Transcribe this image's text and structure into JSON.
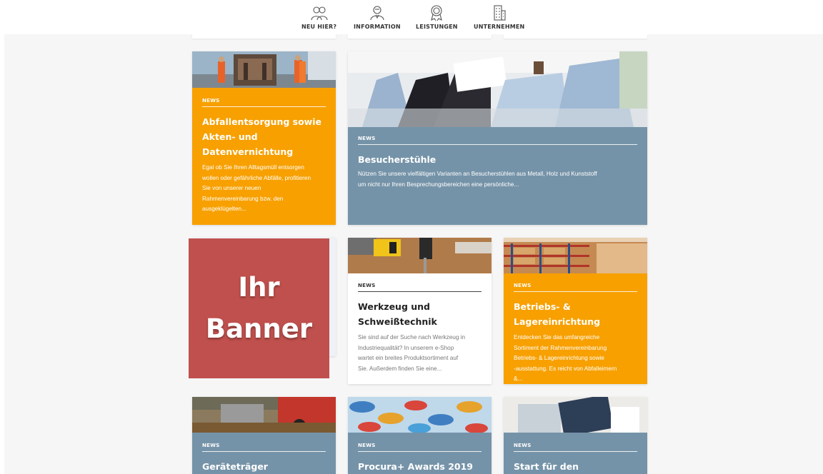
{
  "nav": {
    "items": [
      {
        "label": "NEU HIER?",
        "icon": "people-icon"
      },
      {
        "label": "INFORMATION",
        "icon": "person-info-icon"
      },
      {
        "label": "LEISTUNGEN",
        "icon": "award-icon"
      },
      {
        "label": "UNTERNEHMEN",
        "icon": "building-icon"
      }
    ]
  },
  "banner": {
    "line1": "Ihr",
    "line2": "Banner"
  },
  "cards": [
    {
      "tag": "NEWS",
      "title_lines": [
        "Abfallentsorgung sowie",
        "Akten- und",
        "Datenvernichtung"
      ],
      "text_lines": [
        "Egal ob Sie Ihren Alltagsmüll entsorgen",
        "wollen oder gefährliche Abfälle, profitieren",
        "Sie von unserer neuen",
        "Rahmenvereinbarung bzw. den",
        "ausgeklügelten..."
      ]
    },
    {
      "tag": "NEWS",
      "title_lines": [
        "Besucherstühle"
      ],
      "text_lines": [
        "Nützen Sie unsere vielfältigen Varianten an Besucherstühlen aus Metall, Holz und Kunststoff",
        "um nicht nur Ihren Besprechungsbereichen eine persönliche..."
      ]
    },
    {
      "tag": "NEWS",
      "title_lines": [
        "Werkzeug und",
        "Schweißtechnik"
      ],
      "text_lines": [
        "Sie sind auf der Suche nach Werkzeug in",
        "Industriequalität? In unserem e-Shop",
        "wartet ein breites Produktsortiment auf",
        "Sie. Außerdem finden Sie eine..."
      ]
    },
    {
      "tag": "NEWS",
      "title_lines": [
        "Betriebs- & Lagereinrichtung"
      ],
      "text_lines": [
        "Entdecken Sie das umfangreiche",
        "Sortiment der Rahmenvereinbarung",
        "Betriebs- & Lagereinrichtung sowie",
        "-ausstattung. Es reicht von Abfalleimern",
        "&..."
      ]
    },
    {
      "tag": "NEWS",
      "title_lines": [
        "Geräteträger"
      ],
      "text_lines": []
    },
    {
      "tag": "NEWS",
      "title_lines": [
        "Procura+ Awards 2019"
      ],
      "text_lines": []
    },
    {
      "tag": "NEWS",
      "title_lines": [
        "Start für den"
      ],
      "text_lines": []
    }
  ],
  "colors": {
    "orange": "#f7a000",
    "slate": "#7593a8",
    "banner": "#c0504d"
  }
}
